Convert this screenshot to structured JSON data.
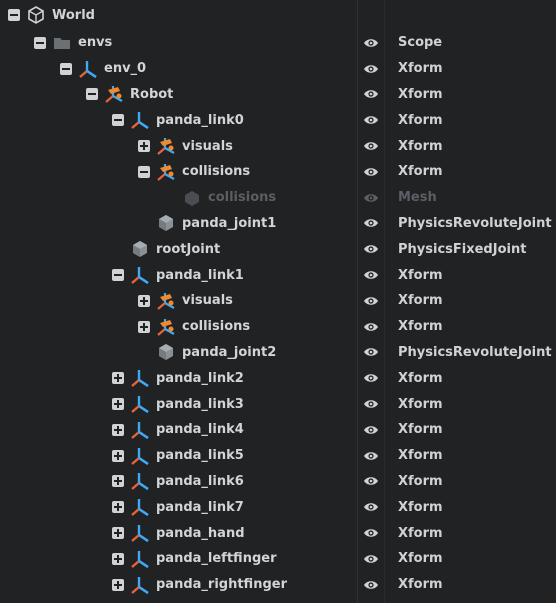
{
  "tree": [
    {
      "label": "World",
      "type": "",
      "indent": 0,
      "toggle": "minus",
      "icon": "world-icon",
      "dim": false
    },
    {
      "label": "envs",
      "type": "Scope",
      "indent": 1,
      "toggle": "minus",
      "icon": "folder-icon",
      "dim": false
    },
    {
      "label": "env_0",
      "type": "Xform",
      "indent": 2,
      "toggle": "minus",
      "icon": "xform-icon",
      "dim": false
    },
    {
      "label": "Robot",
      "type": "Xform",
      "indent": 3,
      "toggle": "minus",
      "icon": "robot-icon",
      "dim": false
    },
    {
      "label": "panda_link0",
      "type": "Xform",
      "indent": 4,
      "toggle": "minus",
      "icon": "xform-icon",
      "dim": false
    },
    {
      "label": "visuals",
      "type": "Xform",
      "indent": 5,
      "toggle": "plus",
      "icon": "robot-icon",
      "dim": false
    },
    {
      "label": "collisions",
      "type": "Xform",
      "indent": 5,
      "toggle": "minus",
      "icon": "robot-icon",
      "dim": false
    },
    {
      "label": "collisions",
      "type": "Mesh",
      "indent": 6,
      "toggle": "none",
      "icon": "mesh-icon",
      "dim": true
    },
    {
      "label": "panda_joint1",
      "type": "PhysicsRevoluteJoint",
      "indent": 5,
      "toggle": "none",
      "icon": "joint-icon",
      "dim": false
    },
    {
      "label": "rootJoint",
      "type": "PhysicsFixedJoint",
      "indent": 4,
      "toggle": "none",
      "icon": "joint-icon",
      "dim": false
    },
    {
      "label": "panda_link1",
      "type": "Xform",
      "indent": 4,
      "toggle": "minus",
      "icon": "xform-icon",
      "dim": false
    },
    {
      "label": "visuals",
      "type": "Xform",
      "indent": 5,
      "toggle": "plus",
      "icon": "robot-icon",
      "dim": false
    },
    {
      "label": "collisions",
      "type": "Xform",
      "indent": 5,
      "toggle": "plus",
      "icon": "robot-icon",
      "dim": false
    },
    {
      "label": "panda_joint2",
      "type": "PhysicsRevoluteJoint",
      "indent": 5,
      "toggle": "none",
      "icon": "joint-icon",
      "dim": false
    },
    {
      "label": "panda_link2",
      "type": "Xform",
      "indent": 4,
      "toggle": "plus",
      "icon": "xform-icon",
      "dim": false
    },
    {
      "label": "panda_link3",
      "type": "Xform",
      "indent": 4,
      "toggle": "plus",
      "icon": "xform-icon",
      "dim": false
    },
    {
      "label": "panda_link4",
      "type": "Xform",
      "indent": 4,
      "toggle": "plus",
      "icon": "xform-icon",
      "dim": false
    },
    {
      "label": "panda_link5",
      "type": "Xform",
      "indent": 4,
      "toggle": "plus",
      "icon": "xform-icon",
      "dim": false
    },
    {
      "label": "panda_link6",
      "type": "Xform",
      "indent": 4,
      "toggle": "plus",
      "icon": "xform-icon",
      "dim": false
    },
    {
      "label": "panda_link7",
      "type": "Xform",
      "indent": 4,
      "toggle": "plus",
      "icon": "xform-icon",
      "dim": false
    },
    {
      "label": "panda_hand",
      "type": "Xform",
      "indent": 4,
      "toggle": "plus",
      "icon": "xform-icon",
      "dim": false
    },
    {
      "label": "panda_leftfinger",
      "type": "Xform",
      "indent": 4,
      "toggle": "plus",
      "icon": "xform-icon",
      "dim": false
    },
    {
      "label": "panda_rightfinger",
      "type": "Xform",
      "indent": 4,
      "toggle": "plus",
      "icon": "xform-icon",
      "dim": false
    }
  ],
  "colors": {
    "background": "#202224",
    "text": "#d2d5d8",
    "dim_text": "#5a5f63",
    "axis_red": "#e8623a",
    "axis_green": "#9acd32",
    "axis_blue": "#3fa9f5",
    "robot_orange": "#f08a2c"
  }
}
